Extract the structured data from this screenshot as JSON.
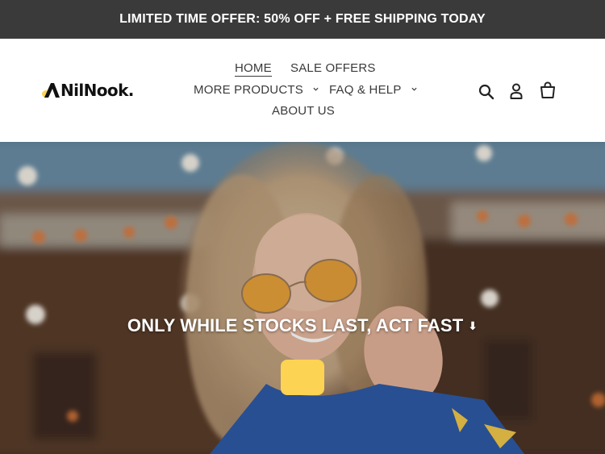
{
  "announcement": {
    "text": "LIMITED TIME OFFER: 50% OFF + FREE SHIPPING TODAY"
  },
  "brand": {
    "name": "NilNook.",
    "accent_color": "#fcd353"
  },
  "nav": {
    "items": [
      {
        "label": "HOME",
        "active": true
      },
      {
        "label": "SALE OFFERS"
      },
      {
        "label": "MORE PRODUCTS",
        "has_dropdown": true
      },
      {
        "label": "FAQ & HELP",
        "has_dropdown": true
      },
      {
        "label": "ABOUT US"
      }
    ]
  },
  "header_icons": [
    "search-icon",
    "account-icon",
    "cart-icon"
  ],
  "hero": {
    "heading": "ONLY WHILE STOCKS LAST, ACT FAST",
    "heading_arrow": "⬇",
    "button_label": "",
    "button_color": "#fcd353"
  },
  "colors": {
    "announcement_bg": "#3a3a3a",
    "text": "#3a3a3a"
  }
}
